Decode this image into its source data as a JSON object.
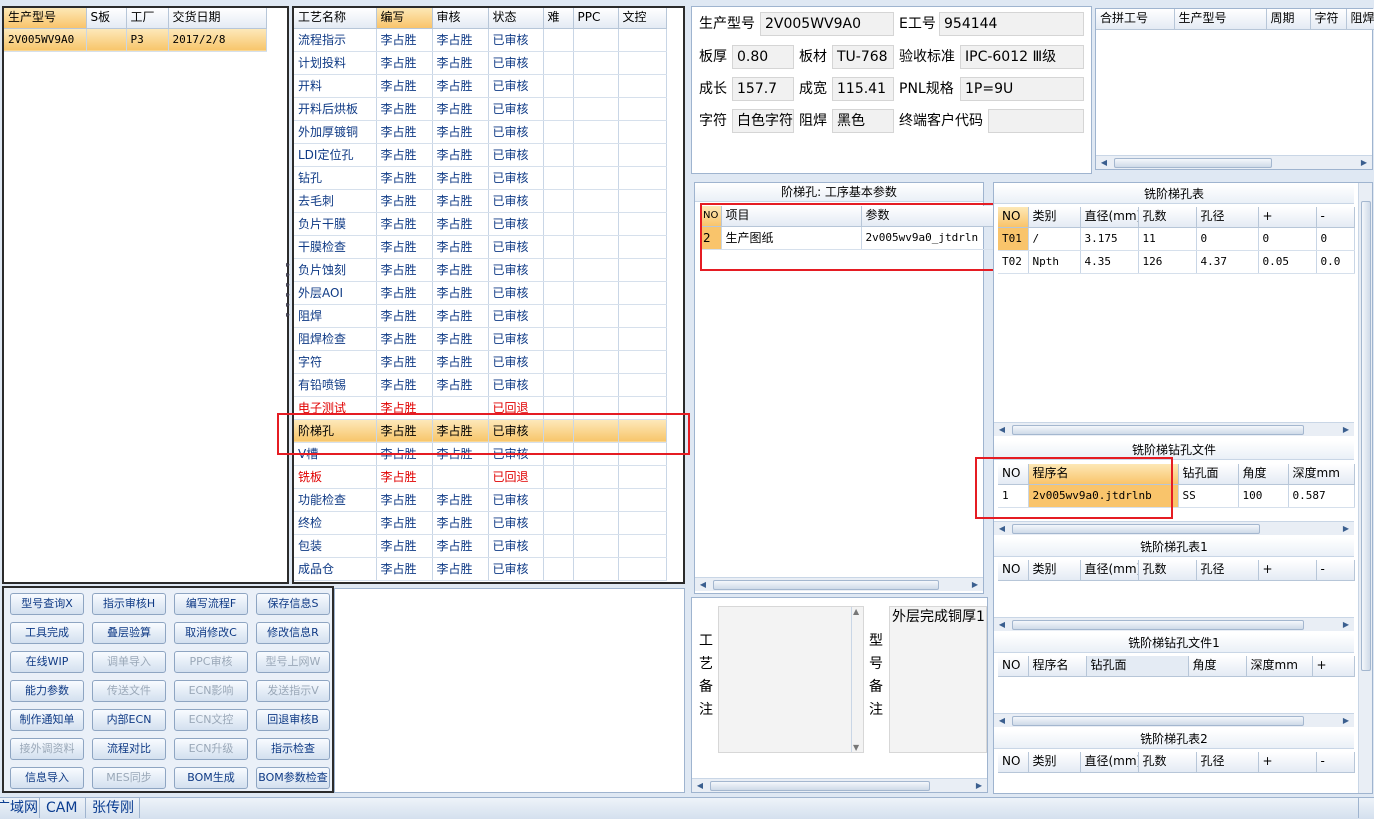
{
  "model_list": {
    "columns": [
      "生产型号",
      "S板",
      "工厂",
      "交货日期"
    ],
    "rows": [
      [
        "2V005WV9A0",
        "",
        "P3",
        "2017/2/8"
      ]
    ]
  },
  "process": {
    "columns": [
      "工艺名称",
      "编写",
      "审核",
      "状态",
      "难",
      "PPC",
      "文控"
    ],
    "rows": [
      {
        "name": "流程指示",
        "writer": "李占胜",
        "reviewer": "李占胜",
        "status": "已审核"
      },
      {
        "name": "计划投料",
        "writer": "李占胜",
        "reviewer": "李占胜",
        "status": "已审核"
      },
      {
        "name": "开料",
        "writer": "李占胜",
        "reviewer": "李占胜",
        "status": "已审核"
      },
      {
        "name": "开料后烘板",
        "writer": "李占胜",
        "reviewer": "李占胜",
        "status": "已审核"
      },
      {
        "name": "外加厚镀铜",
        "writer": "李占胜",
        "reviewer": "李占胜",
        "status": "已审核"
      },
      {
        "name": "LDI定位孔",
        "writer": "李占胜",
        "reviewer": "李占胜",
        "status": "已审核"
      },
      {
        "name": "钻孔",
        "writer": "李占胜",
        "reviewer": "李占胜",
        "status": "已审核"
      },
      {
        "name": "去毛刺",
        "writer": "李占胜",
        "reviewer": "李占胜",
        "status": "已审核"
      },
      {
        "name": "负片干膜",
        "writer": "李占胜",
        "reviewer": "李占胜",
        "status": "已审核"
      },
      {
        "name": "干膜检查",
        "writer": "李占胜",
        "reviewer": "李占胜",
        "status": "已审核"
      },
      {
        "name": "负片蚀刻",
        "writer": "李占胜",
        "reviewer": "李占胜",
        "status": "已审核"
      },
      {
        "name": "外层AOI",
        "writer": "李占胜",
        "reviewer": "李占胜",
        "status": "已审核"
      },
      {
        "name": "阻焊",
        "writer": "李占胜",
        "reviewer": "李占胜",
        "status": "已审核"
      },
      {
        "name": "阻焊检查",
        "writer": "李占胜",
        "reviewer": "李占胜",
        "status": "已审核"
      },
      {
        "name": "字符",
        "writer": "李占胜",
        "reviewer": "李占胜",
        "status": "已审核"
      },
      {
        "name": "有铅喷锡",
        "writer": "李占胜",
        "reviewer": "李占胜",
        "status": "已审核"
      },
      {
        "name": "电子测试",
        "writer": "李占胜",
        "reviewer": "",
        "status": "已回退",
        "red": true
      },
      {
        "name": "阶梯孔",
        "writer": "李占胜",
        "reviewer": "李占胜",
        "status": "已审核",
        "selected": true
      },
      {
        "name": "V槽",
        "writer": "李占胜",
        "reviewer": "李占胜",
        "status": "已审核"
      },
      {
        "name": "铣板",
        "writer": "李占胜",
        "reviewer": "",
        "status": "已回退",
        "red": true
      },
      {
        "name": "功能检查",
        "writer": "李占胜",
        "reviewer": "李占胜",
        "status": "已审核"
      },
      {
        "name": "终检",
        "writer": "李占胜",
        "reviewer": "李占胜",
        "status": "已审核"
      },
      {
        "name": "包装",
        "writer": "李占胜",
        "reviewer": "李占胜",
        "status": "已审核"
      },
      {
        "name": "成品仓",
        "writer": "李占胜",
        "reviewer": "李占胜",
        "status": "已审核"
      }
    ]
  },
  "buttons": [
    [
      "型号查询X",
      "指示审核H",
      "编写流程F",
      "保存信息S"
    ],
    [
      "工具完成",
      "叠层验算",
      "取消修改C",
      "修改信息R"
    ],
    [
      "在线WIP",
      "调单导入",
      "PPC审核",
      "型号上网W"
    ],
    [
      "能力参数",
      "传送文件",
      "ECN影响",
      "发送指示V"
    ],
    [
      "制作通知单",
      "内部ECN",
      "ECN文控",
      "回退审核B"
    ],
    [
      "接外调资料",
      "流程对比",
      "ECN升级",
      "指示检查"
    ],
    [
      "信息导入",
      "MES同步",
      "BOM生成",
      "BOM参数检查"
    ]
  ],
  "disabled_buttons": [
    "调单导入",
    "PPC审核",
    "型号上网W",
    "传送文件",
    "ECN影响",
    "发送指示V",
    "ECN文控",
    "接外调资料",
    "ECN升级",
    "MES同步"
  ],
  "info": {
    "model_label": "生产型号",
    "model": "2V005WV9A0",
    "eno_label": "E工号",
    "eno": "954144",
    "thickness_label": "板厚",
    "thickness": "0.80",
    "material_label": "板材",
    "material": "TU-768",
    "standard_label": "验收标准",
    "standard": "IPC-6012 Ⅲ级",
    "length_label": "成长",
    "length": "157.7",
    "width_label": "成宽",
    "width": "115.41",
    "pnl_label": "PNL规格",
    "pnl": "1P=9U",
    "char_label": "字符",
    "char": "白色字符",
    "mask_label": "阻焊",
    "mask": "黑色",
    "customer_label": "终端客户代码",
    "customer": ""
  },
  "merge": {
    "columns": [
      "合拼工号",
      "生产型号",
      "周期",
      "字符",
      "阻焊"
    ]
  },
  "params": {
    "title": "阶梯孔: 工序基本参数",
    "columns": [
      "NO",
      "项目",
      "参数"
    ],
    "rows": [
      [
        "2",
        "生产图纸",
        "2v005wv9a0_jtdrln"
      ]
    ]
  },
  "mill_hole": {
    "title": "铣阶梯孔表",
    "columns": [
      "NO",
      "类别",
      "直径(mm)",
      "孔数",
      "孔径",
      "+",
      "-"
    ],
    "rows": [
      [
        "T01",
        "/",
        "3.175",
        "11",
        "0",
        "0",
        "0"
      ],
      [
        "T02",
        "Npth",
        "4.35",
        "126",
        "4.37",
        "0.05",
        "0.0"
      ]
    ]
  },
  "mill_drill": {
    "title": "铣阶梯钻孔文件",
    "columns": [
      "NO",
      "程序名",
      "钻孔面",
      "角度",
      "深度mm"
    ],
    "rows": [
      [
        "1",
        "2v005wv9a0.jtdrlnb",
        "SS",
        "100",
        "0.587"
      ]
    ]
  },
  "mill_hole1": {
    "title": "铣阶梯孔表1",
    "columns": [
      "NO",
      "类别",
      "直径(mm)",
      "孔数",
      "孔径",
      "+",
      "-"
    ]
  },
  "mill_drill1": {
    "title": "铣阶梯钻孔文件1",
    "columns": [
      "NO",
      "程序名",
      "钻孔面",
      "角度",
      "深度mm",
      "+"
    ]
  },
  "mill_hole2": {
    "title": "铣阶梯孔表2",
    "columns": [
      "NO",
      "类别",
      "直径(mm)",
      "孔数",
      "孔径",
      "+",
      "-"
    ]
  },
  "notes": {
    "process_note_label": [
      "工",
      "艺",
      "备",
      "注"
    ],
    "model_note_label": [
      "型",
      "号",
      "备",
      "注"
    ],
    "model_note_text": "外层完成铜厚1"
  },
  "status_bar": [
    "广域网",
    "CAM",
    "张传刚"
  ]
}
